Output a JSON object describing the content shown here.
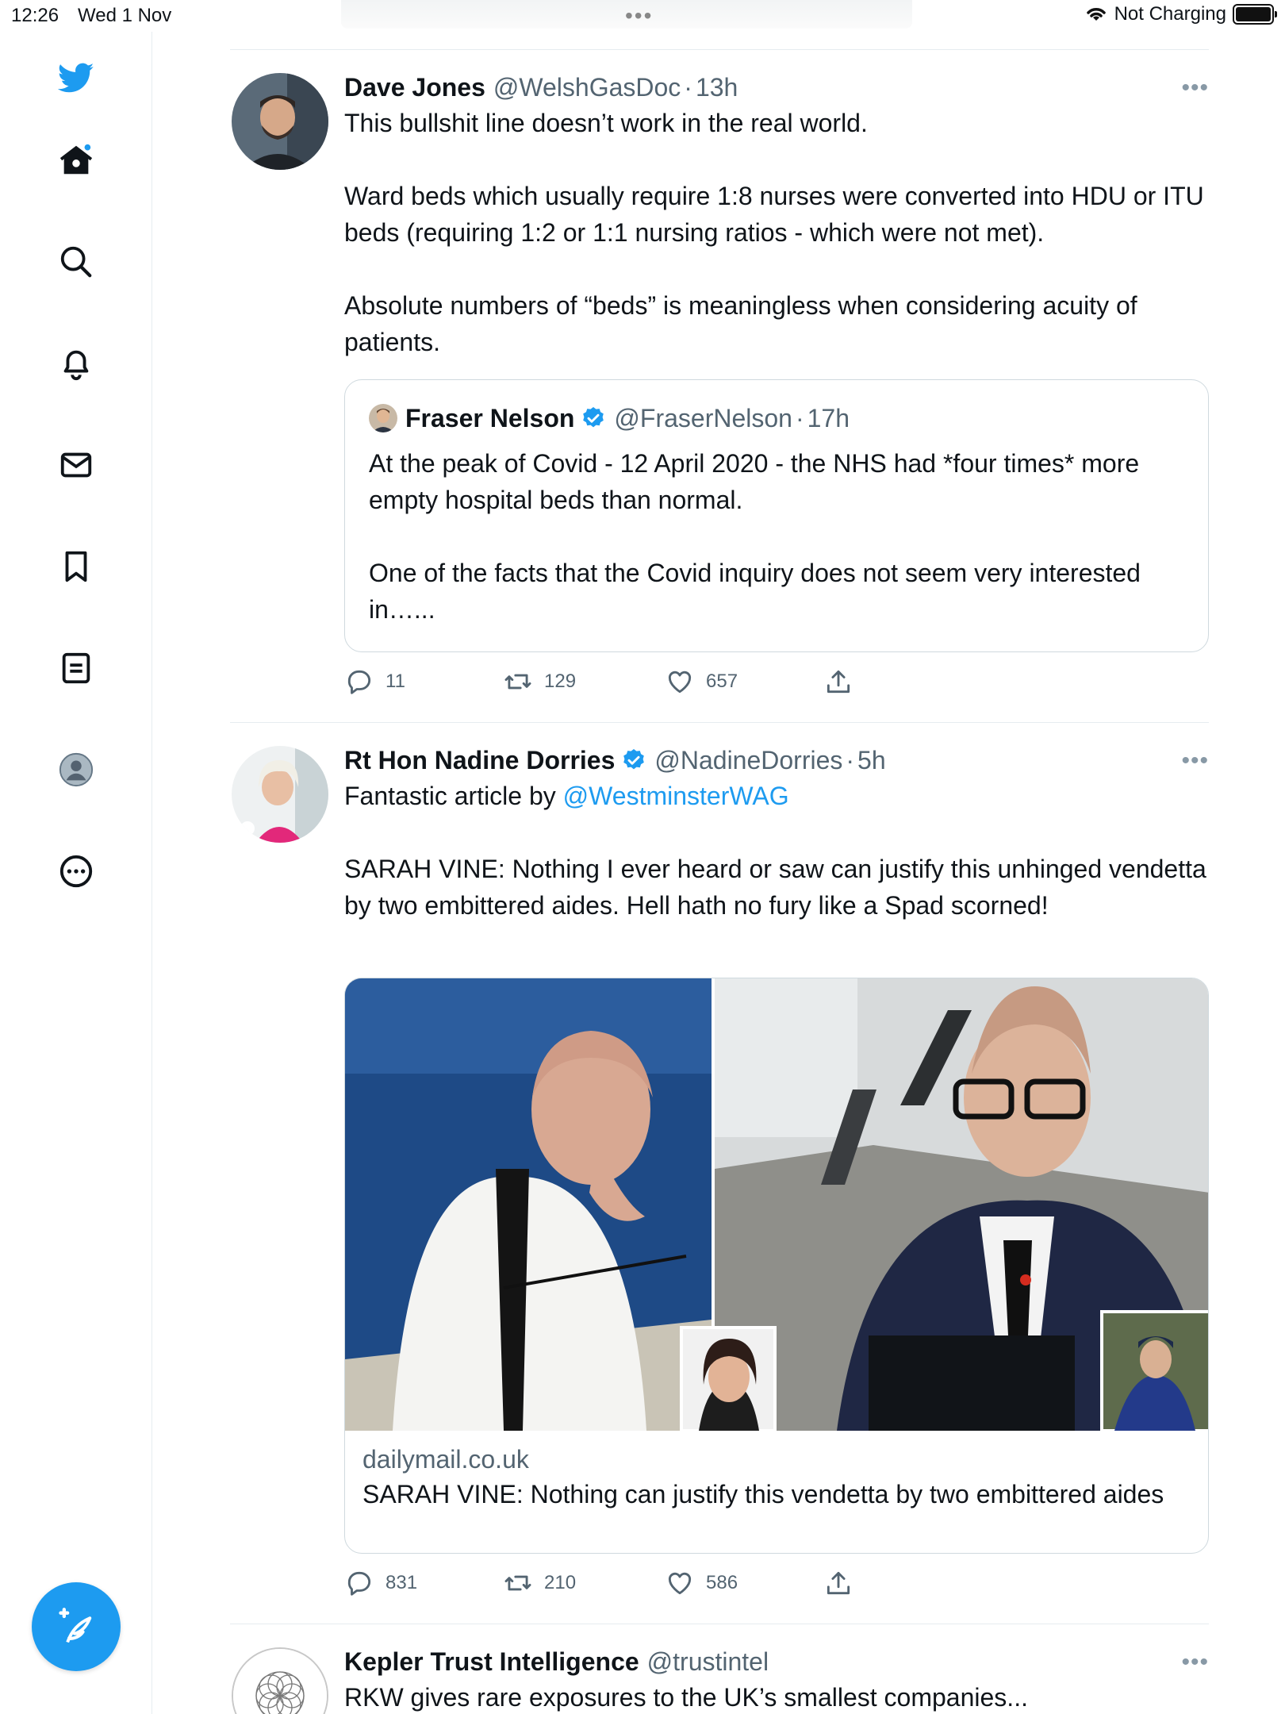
{
  "status_bar": {
    "time": "12:26",
    "date": "Wed 1 Nov",
    "network": "Not Charging"
  },
  "sidebar": {
    "items": [
      {
        "name": "home"
      },
      {
        "name": "search"
      },
      {
        "name": "notifications"
      },
      {
        "name": "messages"
      },
      {
        "name": "bookmarks"
      },
      {
        "name": "lists"
      },
      {
        "name": "profile"
      },
      {
        "name": "more"
      }
    ]
  },
  "tweets": [
    {
      "name": "Dave Jones",
      "handle": "@WelshGasDoc",
      "sep": "·",
      "time": "13h",
      "text": [
        "This bullshit line doesn’t work in the real world.",
        "Ward beds which usually require 1:8 nurses were converted into HDU or ITU beds (requiring 1:2 or 1:1 nursing ratios - which were not met).",
        "Absolute numbers of “beds” is meaningless when considering acuity of patients."
      ],
      "quote": {
        "name": "Fraser Nelson",
        "handle": "@FraserNelson",
        "sep": "·",
        "time": "17h",
        "text": [
          "At the peak of Covid - 12 April 2020 - the NHS had *four times* more empty hospital beds than normal.",
          "One of the facts that the Covid inquiry does not seem very interested in…..."
        ]
      },
      "replies": "11",
      "retweets": "129",
      "likes": "657"
    },
    {
      "name": "Rt Hon Nadine Dorries",
      "handle": "@NadineDorries",
      "sep": "·",
      "time": "5h",
      "text_prefix": "Fantastic article by ",
      "mention": "@WestminsterWAG",
      "text2": "SARAH VINE: Nothing I ever heard or saw can justify this unhinged vendetta by two embittered aides. Hell hath no fury like a Spad scorned!",
      "card": {
        "domain": "dailymail.co.uk",
        "title": "SARAH VINE: Nothing can justify this vendetta by two embittered aides"
      },
      "replies": "831",
      "retweets": "210",
      "likes": "586"
    },
    {
      "name": "Kepler Trust Intelligence",
      "handle": "@trustintel",
      "text": "RKW gives rare exposures to the UK’s smallest companies..."
    }
  ],
  "more_label": "•••",
  "colors": {
    "accent": "#1d9bf0",
    "secondary_text": "#536471",
    "border": "#cfd9de"
  }
}
